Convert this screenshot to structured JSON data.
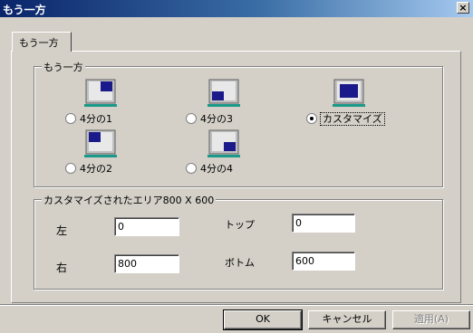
{
  "window": {
    "title": "もう一方",
    "close_label": "×"
  },
  "tab": {
    "label": "もう一方"
  },
  "layout_group": {
    "legend": "もう一方",
    "options": [
      {
        "label": "4分の1",
        "checked": false,
        "icon": "monitor-top-right-quarter-icon"
      },
      {
        "label": "4分の3",
        "checked": false,
        "icon": "monitor-bottom-left-quarter-icon"
      },
      {
        "label": "カスタマイズ",
        "checked": true,
        "icon": "monitor-custom-area-icon"
      },
      {
        "label": "4分の2",
        "checked": false,
        "icon": "monitor-top-left-quarter-icon"
      },
      {
        "label": "4分の4",
        "checked": false,
        "icon": "monitor-bottom-right-quarter-icon"
      }
    ]
  },
  "custom_group": {
    "legend": "カスタマイズされたエリア800 X 600",
    "left_label": "左",
    "left_value": "0",
    "top_label": "トップ",
    "top_value": "0",
    "right_label": "右",
    "right_value": "800",
    "bottom_label": "ボトム",
    "bottom_value": "600"
  },
  "buttons": {
    "ok": "OK",
    "cancel": "キャンセル",
    "apply": "適用(A)"
  },
  "colors": {
    "title_bar": "#0a246a",
    "dialog_bg": "#d4d0c8",
    "monitor_screen": "#1a1a8a",
    "monitor_base": "#1a9a8a"
  }
}
